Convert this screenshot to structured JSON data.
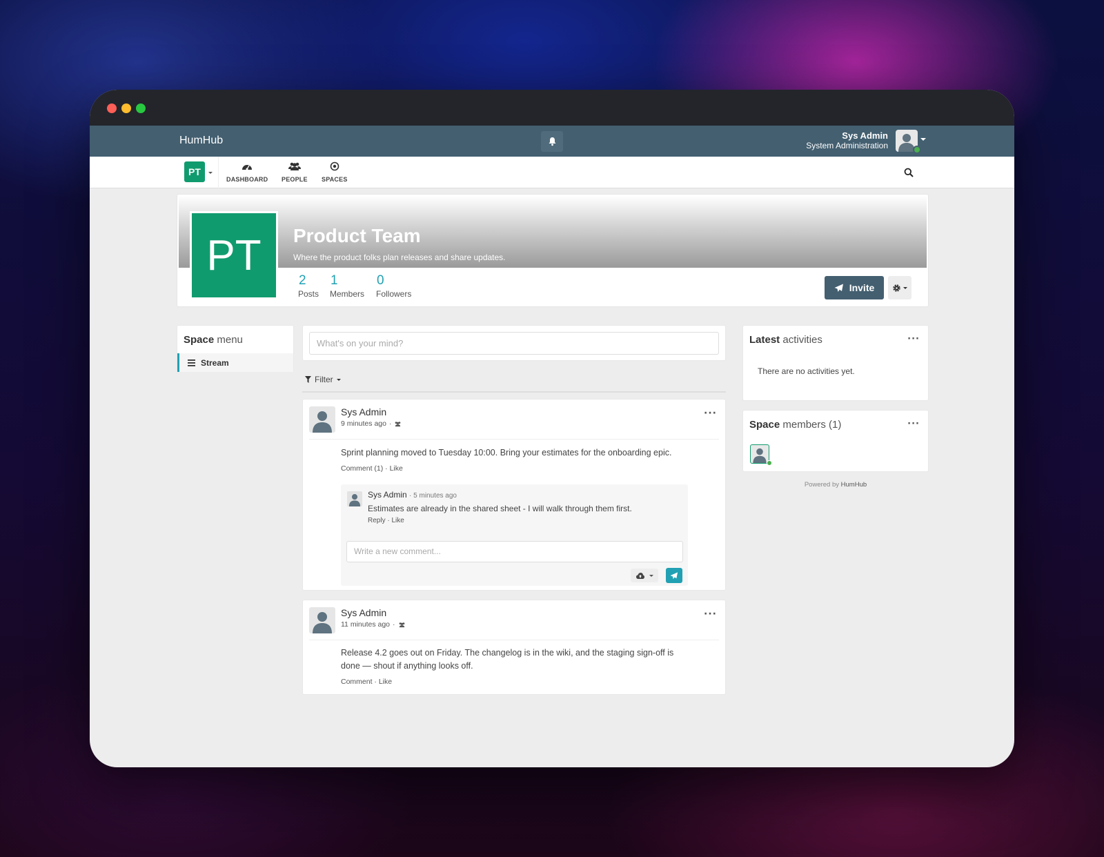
{
  "app": {
    "brand": "HumHub"
  },
  "user": {
    "name": "Sys Admin",
    "role": "System Administration"
  },
  "nav": {
    "space_initials": "PT",
    "items": [
      {
        "label": "DASHBOARD",
        "icon": "dashboard-icon"
      },
      {
        "label": "PEOPLE",
        "icon": "people-icon"
      },
      {
        "label": "SPACES",
        "icon": "spaces-icon"
      }
    ]
  },
  "space": {
    "initials": "PT",
    "title": "Product Team",
    "description": "Where the product folks plan releases and share updates.",
    "color": "#109b6e",
    "stats": [
      {
        "value": "2",
        "label": "Posts"
      },
      {
        "value": "1",
        "label": "Members"
      },
      {
        "value": "0",
        "label": "Followers"
      }
    ],
    "invite_label": "Invite"
  },
  "space_menu": {
    "heading_bold": "Space",
    "heading_rest": " menu",
    "items": [
      {
        "label": "Stream"
      }
    ]
  },
  "composer": {
    "placeholder": "What's on your mind?"
  },
  "filter": {
    "label": "Filter"
  },
  "posts": [
    {
      "author": "Sys Admin",
      "time": "9 minutes ago",
      "text": "Sprint planning moved to Tuesday 10:00. Bring your estimates for the onboarding epic.",
      "actions": "Comment (1) · Like",
      "comment": {
        "author": "Sys Admin",
        "time": "· 5 minutes ago",
        "text": "Estimates are already in the shared sheet - I will walk through them first.",
        "actions": "Reply · Like"
      },
      "comment_placeholder": "Write a new comment..."
    },
    {
      "author": "Sys Admin",
      "time": "11 minutes ago",
      "text": "Release 4.2 goes out on Friday. The changelog is in the wiki, and the staging sign-off is done — shout if anything looks off.",
      "actions": "Comment · Like"
    }
  ],
  "activities": {
    "heading_bold": "Latest",
    "heading_rest": " activities",
    "empty": "There are no activities yet."
  },
  "members": {
    "heading_bold": "Space",
    "heading_rest": " members (1)"
  },
  "footer": {
    "powered": "Powered by ",
    "brand": "HumHub"
  },
  "colors": {
    "accent": "#21a1b3",
    "topbar": "#435f70",
    "space": "#109b6e",
    "online": "#4bb04f"
  }
}
